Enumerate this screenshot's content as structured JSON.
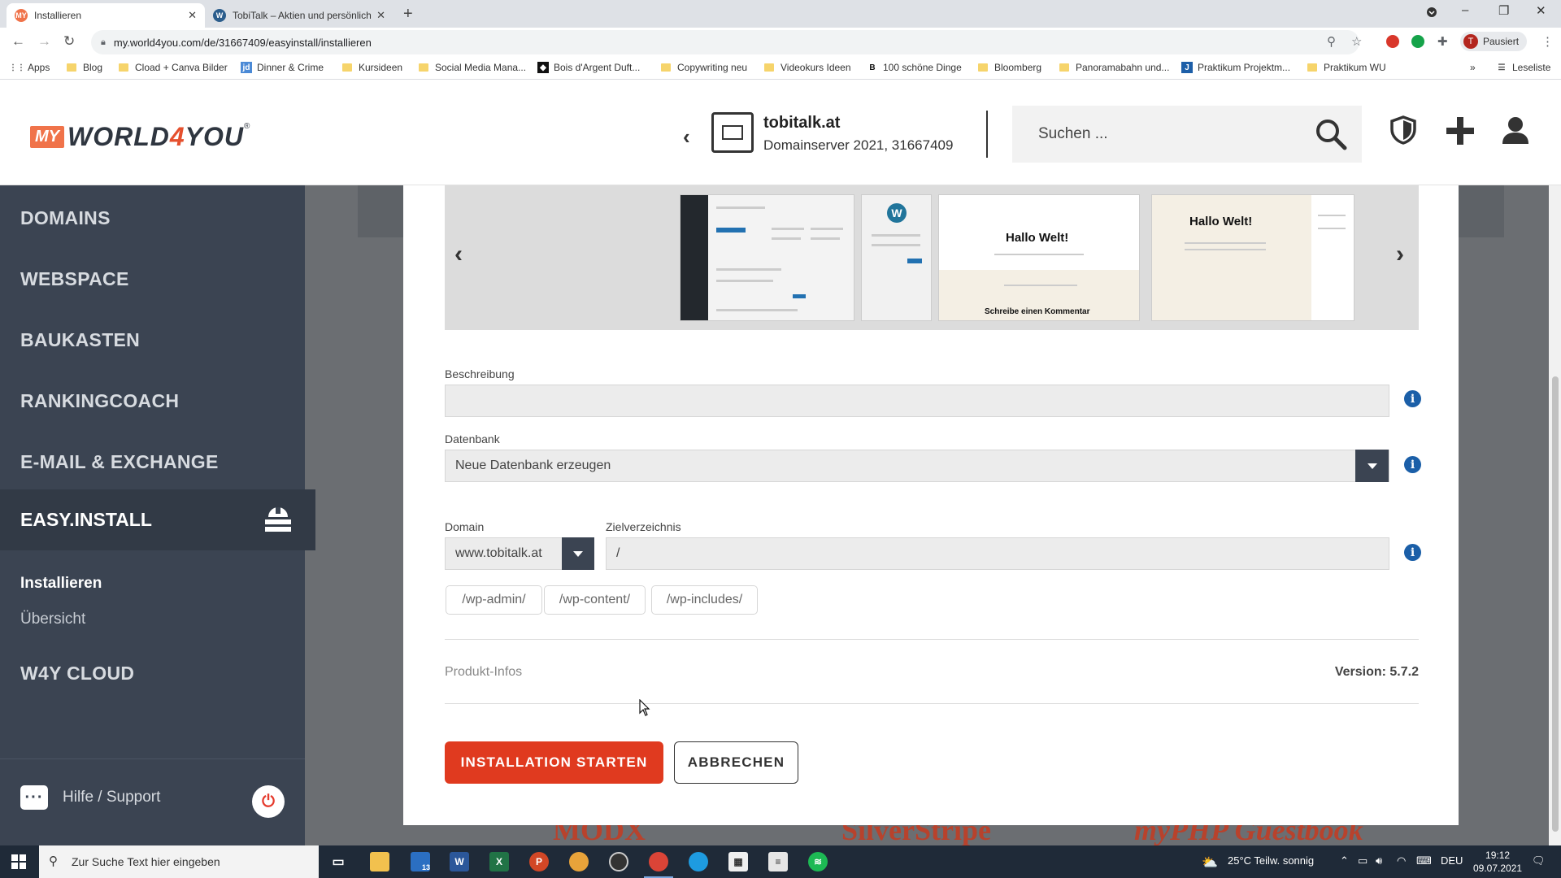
{
  "browser": {
    "tabs": [
      {
        "title": "Installieren",
        "favicon": "MY",
        "active": true
      },
      {
        "title": "TobiTalk – Aktien und persönliche",
        "favicon": "W",
        "active": false
      }
    ],
    "url": "my.world4you.com/de/31667409/easyinstall/installieren",
    "profile_label": "Pausiert",
    "profile_initial": "T",
    "bookmarks": [
      {
        "label": "Apps",
        "icon": "apps-grid"
      },
      {
        "label": "Blog",
        "icon": "folder"
      },
      {
        "label": "Cload + Canva Bilder",
        "icon": "folder"
      },
      {
        "label": "Dinner & Crime",
        "icon": "jd"
      },
      {
        "label": "Kursideen",
        "icon": "folder"
      },
      {
        "label": "Social Media Mana...",
        "icon": "folder"
      },
      {
        "label": "Bois d'Argent Duft...",
        "icon": "site"
      },
      {
        "label": "Copywriting neu",
        "icon": "folder"
      },
      {
        "label": "Videokurs Ideen",
        "icon": "folder"
      },
      {
        "label": "100 schöne Dinge",
        "icon": "B"
      },
      {
        "label": "Bloomberg",
        "icon": "folder"
      },
      {
        "label": "Panoramabahn und...",
        "icon": "folder"
      },
      {
        "label": "Praktikum Projektm...",
        "icon": "J"
      },
      {
        "label": "Praktikum WU",
        "icon": "folder"
      }
    ],
    "reading_list": "Leseliste"
  },
  "header": {
    "logo_my": "MY",
    "logo_brand_a": "WORLD",
    "logo_brand_b": "4",
    "logo_brand_c": "YOU",
    "logo_reg": "®",
    "server_name": "tobitalk.at",
    "server_sub": "Domainserver 2021, 31667409",
    "search_placeholder": "Suchen ..."
  },
  "sidebar": {
    "items": [
      "DOMAINS",
      "WEBSPACE",
      "BAUKASTEN",
      "RANKINGCOACH",
      "E-MAIL & EXCHANGE"
    ],
    "active": "EASY.INSTALL",
    "sub_items": [
      "Installieren",
      "Übersicht"
    ],
    "after": "W4Y CLOUD",
    "help": "Hilfe / Support"
  },
  "carousel": {
    "screens": [
      {
        "kind": "admin"
      },
      {
        "kind": "login"
      },
      {
        "kind": "theme",
        "title": "Hallo Welt!",
        "caption": "Schreibe einen Kommentar"
      },
      {
        "kind": "theme2",
        "title": "Hallo Welt!"
      }
    ]
  },
  "form": {
    "beschreibung_label": "Beschreibung",
    "beschreibung_value": "",
    "datenbank_label": "Datenbank",
    "datenbank_value": "Neue Datenbank erzeugen",
    "domain_label": "Domain",
    "domain_value": "www.tobitalk.at",
    "zielverzeichnis_label": "Zielverzeichnis",
    "zielverzeichnis_value": "/",
    "chips": [
      "/wp-admin/",
      "/wp-content/",
      "/wp-includes/"
    ],
    "produkt_infos": "Produkt-Infos",
    "version": "Version: 5.7.2",
    "start_button": "INSTALLATION STARTEN",
    "cancel_button": "ABBRECHEN"
  },
  "background_logos": [
    "MODX",
    "SilverStripe",
    "myPHP Guestbook"
  ],
  "taskbar": {
    "search_placeholder": "Zur Suche Text hier eingeben",
    "mail_badge": "13",
    "weather": "25°C  Teilw. sonnig",
    "language": "DEU",
    "time": "19:12",
    "date": "09.07.2021"
  },
  "colors": {
    "sidebar": "#3b4452",
    "accent_red": "#e03a1f",
    "info_blue": "#1b5fa8"
  }
}
